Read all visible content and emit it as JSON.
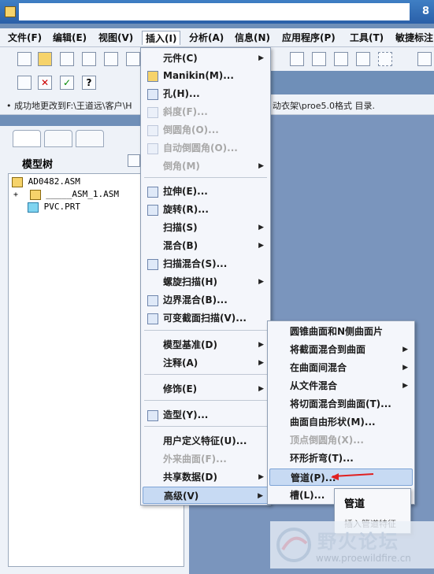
{
  "window": {
    "title_suffix": "8"
  },
  "menubar": {
    "items": [
      "文件(F)",
      "编辑(E)",
      "视图(V)",
      "插入(I)",
      "分析(A)",
      "信息(N)",
      "应用程序(P)",
      "工具(T)",
      "敏捷标注"
    ],
    "active_index": 3
  },
  "status": {
    "message": "• 成功地更改到F:\\王道远\\客户\\H",
    "message_tail": "动衣架\\proe5.0格式 目录."
  },
  "model_tree": {
    "title": "模型树",
    "rows": [
      "AD0482.ASM",
      "_____ASM_1.ASM",
      "PVC.PRT"
    ]
  },
  "insert_menu": {
    "items": [
      {
        "label": "元件(C)",
        "arrow": "▶",
        "disabled": false
      },
      {
        "label": "Manikin(M)...",
        "disabled": false
      },
      {
        "label": "孔(H)...",
        "disabled": false
      },
      {
        "label": "斜度(F)...",
        "disabled": true
      },
      {
        "label": "倒圆角(O)...",
        "disabled": true
      },
      {
        "label": "自动倒圆角(O)...",
        "disabled": true
      },
      {
        "label": "倒角(M)",
        "arrow": "▶",
        "disabled": true
      },
      {
        "label": "拉伸(E)...",
        "disabled": false
      },
      {
        "label": "旋转(R)...",
        "disabled": false
      },
      {
        "label": "扫描(S)",
        "arrow": "▶",
        "disabled": false
      },
      {
        "label": "混合(B)",
        "arrow": "▶",
        "disabled": false
      },
      {
        "label": "扫描混合(S)...",
        "disabled": false
      },
      {
        "label": "螺旋扫描(H)",
        "arrow": "▶",
        "disabled": false
      },
      {
        "label": "边界混合(B)...",
        "disabled": false
      },
      {
        "label": "可变截面扫描(V)...",
        "disabled": false
      },
      {
        "label": "模型基准(D)",
        "arrow": "▶",
        "disabled": false
      },
      {
        "label": "注释(A)",
        "arrow": "▶",
        "disabled": false
      },
      {
        "label": "修饰(E)",
        "arrow": "▶",
        "disabled": false
      },
      {
        "label": "造型(Y)...",
        "disabled": false
      },
      {
        "label": "用户定义特征(U)...",
        "disabled": false
      },
      {
        "label": "外来曲面(F)...",
        "disabled": true
      },
      {
        "label": "共享数据(D)",
        "arrow": "▶",
        "disabled": false
      },
      {
        "label": "高级(V)",
        "arrow": "▶",
        "disabled": false
      }
    ]
  },
  "advanced_menu": {
    "items": [
      {
        "label": "圆锥曲面和N侧曲面片",
        "disabled": false
      },
      {
        "label": "将截面混合到曲面",
        "arrow": "▶",
        "disabled": false
      },
      {
        "label": "在曲面间混合",
        "arrow": "▶",
        "disabled": false
      },
      {
        "label": "从文件混合",
        "arrow": "▶",
        "disabled": false
      },
      {
        "label": "将切面混合到曲面(T)...",
        "disabled": false
      },
      {
        "label": "曲面自由形状(M)...",
        "disabled": false
      },
      {
        "label": "顶点倒圆角(X)...",
        "disabled": true
      },
      {
        "label": "环形折弯(T)...",
        "disabled": false
      },
      {
        "label": "管道(P)...",
        "disabled": false
      },
      {
        "label": "槽(L)...",
        "disabled": false
      }
    ]
  },
  "tooltip": {
    "title": "管道",
    "description": "插入管道特征"
  },
  "watermark": {
    "brand": "野火论坛",
    "url": "www.proewildfire.cn"
  },
  "colors": {
    "highlight": "#c7daf3",
    "arrow": "#e02020"
  }
}
